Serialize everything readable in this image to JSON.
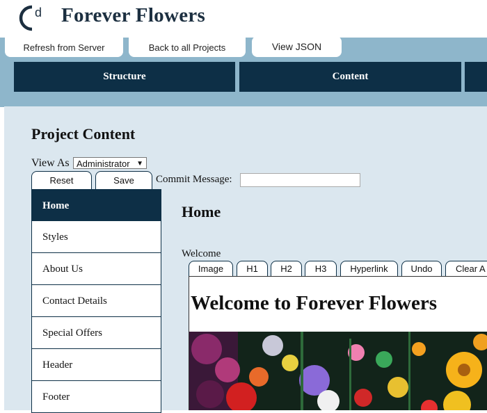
{
  "app": {
    "title": "Forever Flowers",
    "logo_text": "Cd"
  },
  "top_tabs": [
    {
      "label": "Refresh from Server"
    },
    {
      "label": "Back to all Projects"
    },
    {
      "label": "View JSON"
    }
  ],
  "nav": [
    {
      "label": "Structure"
    },
    {
      "label": "Content"
    }
  ],
  "page": {
    "heading": "Project Content",
    "view_as_label": "View As",
    "view_as_value": "Administrator",
    "reset_label": "Reset",
    "save_label": "Save",
    "commit_label": "Commit Message:",
    "commit_value": ""
  },
  "sidebar": {
    "items": [
      {
        "label": "Home"
      },
      {
        "label": "Styles"
      },
      {
        "label": "About Us"
      },
      {
        "label": "Contact Details"
      },
      {
        "label": "Special Offers"
      },
      {
        "label": "Header"
      },
      {
        "label": "Footer"
      }
    ]
  },
  "content": {
    "title": "Home",
    "field_label": "Welcome",
    "toolbar": [
      {
        "label": "Image"
      },
      {
        "label": "H1"
      },
      {
        "label": "H2"
      },
      {
        "label": "H3"
      },
      {
        "label": "Hyperlink"
      },
      {
        "label": "Undo"
      },
      {
        "label": "Clear A"
      }
    ],
    "editor_heading": "Welcome to Forever Flowers"
  },
  "colors": {
    "navy": "#0d2f46",
    "band": "#8eb6cb",
    "panel": "#dbe7ef"
  }
}
